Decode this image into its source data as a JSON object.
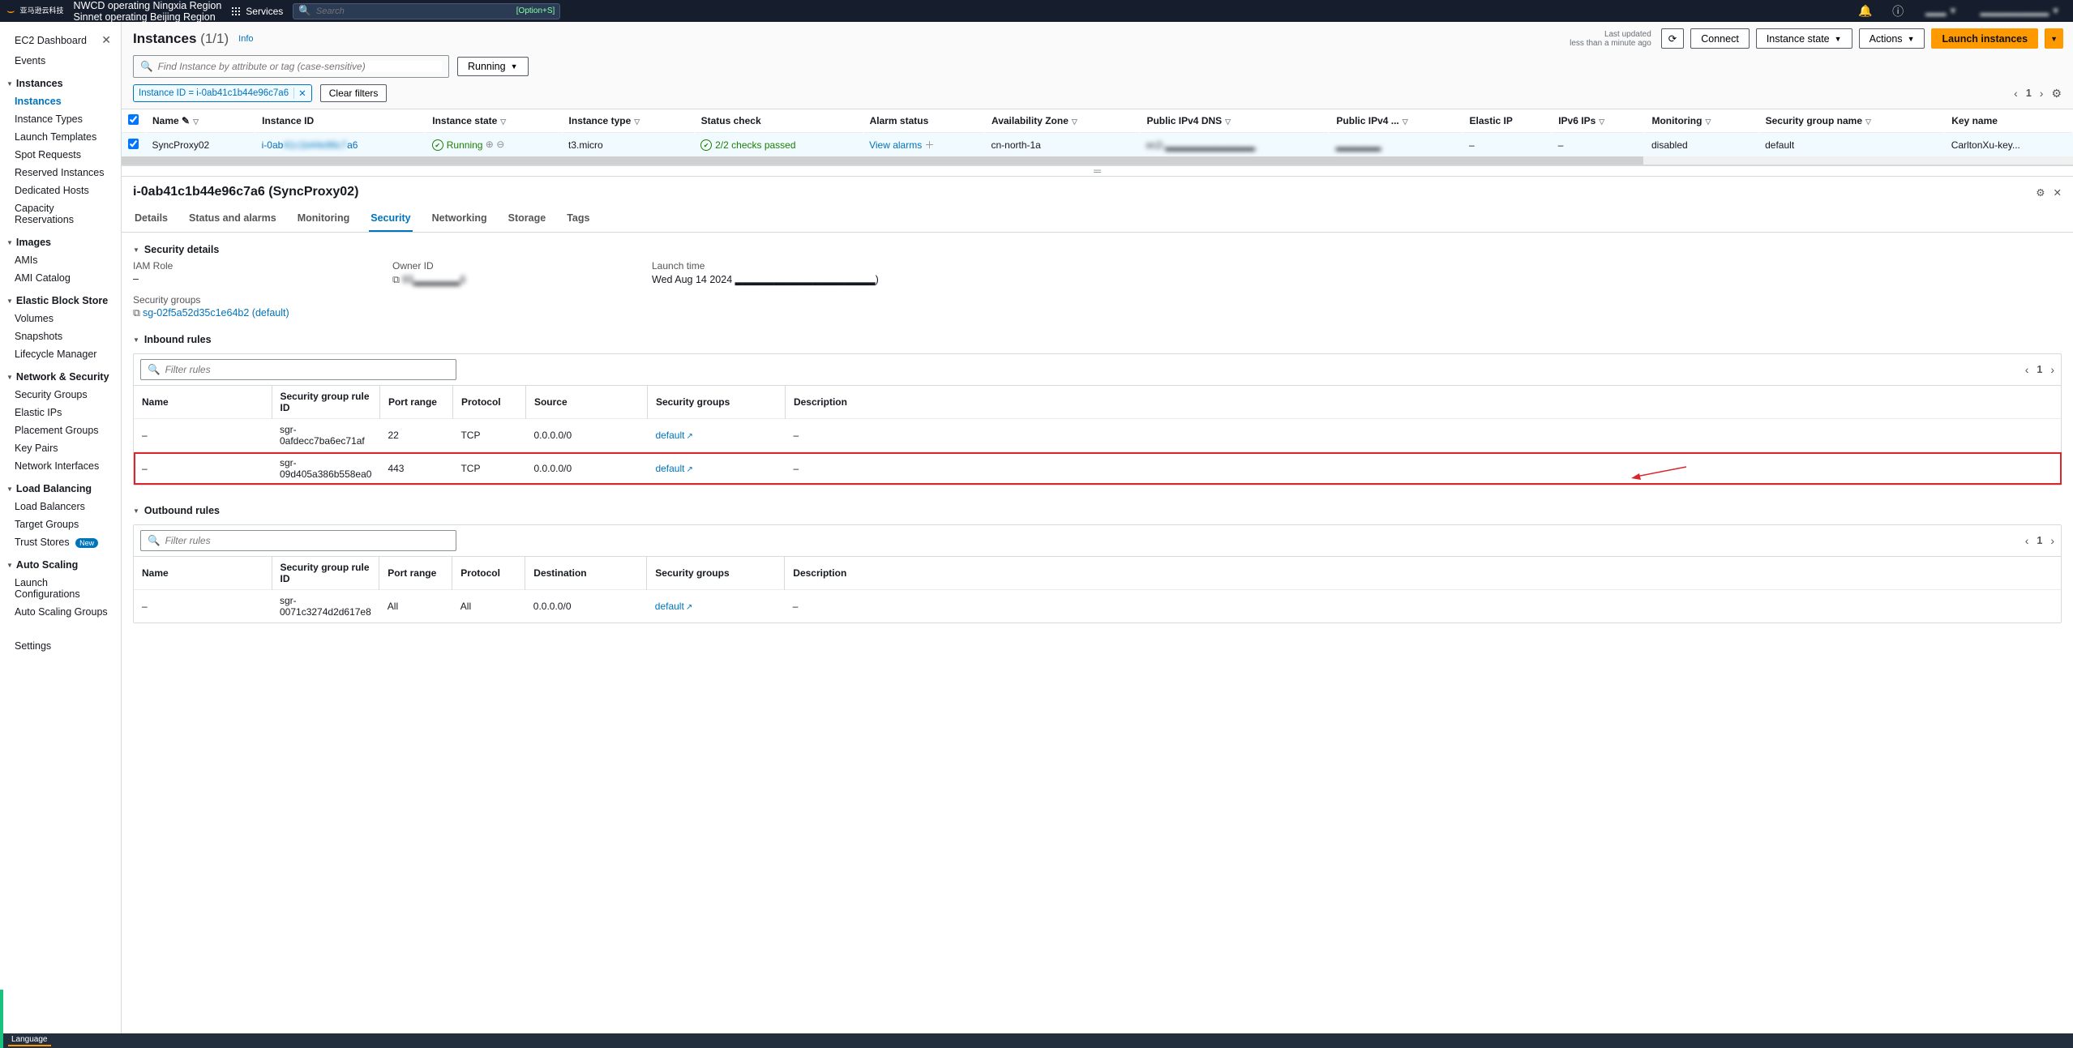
{
  "top": {
    "partner_cn": "亚马逊云科技",
    "region_line1": "NWCD operating Ningxia Region",
    "region_line2": "Sinnet operating Beijing Region",
    "services": "Services",
    "search_placeholder": "Search",
    "search_hint": "[Option+S]",
    "account_region": "▂▂▂ ▼",
    "account_user": "▂▂▂▂▂▂▂▂▂▂ ▼"
  },
  "sidebar": {
    "dashboard": "EC2 Dashboard",
    "events": "Events",
    "groups": {
      "instances": {
        "label": "Instances",
        "items": [
          "Instances",
          "Instance Types",
          "Launch Templates",
          "Spot Requests",
          "Reserved Instances",
          "Dedicated Hosts",
          "Capacity Reservations"
        ]
      },
      "images": {
        "label": "Images",
        "items": [
          "AMIs",
          "AMI Catalog"
        ]
      },
      "ebs": {
        "label": "Elastic Block Store",
        "items": [
          "Volumes",
          "Snapshots",
          "Lifecycle Manager"
        ]
      },
      "net": {
        "label": "Network & Security",
        "items": [
          "Security Groups",
          "Elastic IPs",
          "Placement Groups",
          "Key Pairs",
          "Network Interfaces"
        ]
      },
      "lb": {
        "label": "Load Balancing",
        "items": [
          "Load Balancers",
          "Target Groups",
          "Trust Stores"
        ],
        "badge": "New"
      },
      "as": {
        "label": "Auto Scaling",
        "items": [
          "Launch Configurations",
          "Auto Scaling Groups"
        ]
      }
    },
    "settings": "Settings"
  },
  "header": {
    "title": "Instances",
    "count": "(1/1)",
    "info": "Info",
    "last_updated_l1": "Last updated",
    "last_updated_l2": "less than a minute ago",
    "refresh": "⟳",
    "connect": "Connect",
    "instance_state": "Instance state",
    "actions": "Actions",
    "launch": "Launch instances"
  },
  "filter": {
    "placeholder": "Find Instance by attribute or tag (case-sensitive)",
    "state_btn": "Running",
    "chip": "Instance ID = i-0ab41c1b44e96c7a6",
    "clear": "Clear filters"
  },
  "cols": {
    "name": "Name",
    "iid": "Instance ID",
    "state": "Instance state",
    "type": "Instance type",
    "status": "Status check",
    "alarm": "Alarm status",
    "az": "Availability Zone",
    "dns": "Public IPv4 DNS",
    "ip4": "Public IPv4 ...",
    "eip": "Elastic IP",
    "ip6": "IPv6 IPs",
    "mon": "Monitoring",
    "sg": "Security group name",
    "key": "Key name"
  },
  "row": {
    "name": "SyncProxy02",
    "iid_pre": "i-0ab",
    "iid_post": "a6",
    "state": "Running",
    "type": "t3.micro",
    "status": "2/2 checks passed",
    "alarm": "View alarms",
    "az": "cn-north-1a",
    "dns": "ec2-▂▂▂▂▂▂▂▂▂▂▂▂",
    "ip4": "▂▂▂▂▂▂",
    "eip": "–",
    "ip6": "–",
    "mon": "disabled",
    "sg": "default",
    "key": "CarltonXu-key..."
  },
  "detail": {
    "title": "i-0ab41c1b44e96c7a6 (SyncProxy02)",
    "tabs": [
      "Details",
      "Status and alarms",
      "Monitoring",
      "Security",
      "Networking",
      "Storage",
      "Tags"
    ],
    "active_tab": "Security",
    "sec_details": "Security details",
    "iam_k": "IAM Role",
    "iam_v": "–",
    "owner_k": "Owner ID",
    "owner_v": "93▂▂▂▂▂▂6",
    "launch_k": "Launch time",
    "launch_v": "Wed Aug 14 2024 ▂▂▂▂▂▂▂▂▂▂▂▂▂▂▂▂▂▂)",
    "sg_k": "Security groups",
    "sg_link": "sg-02f5a52d35c1e64b2 (default)",
    "inbound": "Inbound rules",
    "outbound": "Outbound rules",
    "filter_rules": "Filter rules",
    "rcols": {
      "name": "Name",
      "id": "Security group rule ID",
      "port": "Port range",
      "proto": "Protocol",
      "src": "Source",
      "dst": "Destination",
      "sg": "Security groups",
      "desc": "Description"
    },
    "in_rules": [
      {
        "name": "–",
        "id": "sgr-0afdecc7ba6ec71af",
        "port": "22",
        "proto": "TCP",
        "src": "0.0.0.0/0",
        "sg": "default",
        "desc": "–"
      },
      {
        "name": "–",
        "id": "sgr-09d405a386b558ea0",
        "port": "443",
        "proto": "TCP",
        "src": "0.0.0.0/0",
        "sg": "default",
        "desc": "–"
      }
    ],
    "out_rules": [
      {
        "name": "–",
        "id": "sgr-0071c3274d2d617e8",
        "port": "All",
        "proto": "All",
        "dst": "0.0.0.0/0",
        "sg": "default",
        "desc": "–"
      }
    ]
  },
  "footer": {
    "language": "Language"
  }
}
